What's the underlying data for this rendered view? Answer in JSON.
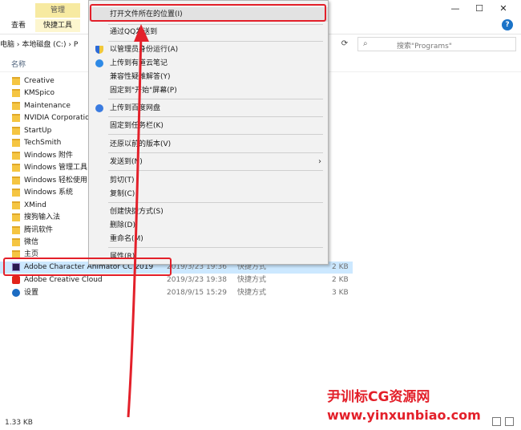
{
  "ribbon": {
    "manage_tab": "管理",
    "view_tab": "查看",
    "tools_tab": "快捷工具",
    "help_label": "?",
    "minimize": "—",
    "maximize": "☐",
    "close": "✕"
  },
  "address": {
    "path": "电脑 › 本地磁盘 (C:) › P",
    "search_placeholder": "搜索\"Programs\""
  },
  "list": {
    "column_name": "名称",
    "folders": [
      "Creative",
      "KMSpico",
      "Maintenance",
      "NVIDIA Corporatio",
      "StartUp",
      "TechSmith",
      "Windows 附件",
      "Windows 管理工具",
      "Windows 轻松使用",
      "Windows 系统",
      "XMind",
      "搜狗输入法",
      "腾讯软件",
      "微信",
      "主页"
    ],
    "files": [
      {
        "name": "Adobe Character Animator CC 2019",
        "date": "2019/3/23 19:36",
        "type": "快捷方式",
        "size": "2 KB"
      },
      {
        "name": "Adobe Creative Cloud",
        "date": "2019/3/23 19:38",
        "type": "快捷方式",
        "size": "2 KB"
      },
      {
        "name": "设置",
        "date": "2018/9/15 15:29",
        "type": "快捷方式",
        "size": "3 KB"
      }
    ]
  },
  "status": {
    "text": "1.33 KB"
  },
  "context_menu": {
    "items": [
      "打开文件所在的位置(I)",
      "通过QQ发送到",
      "以管理员身份运行(A)",
      "上传到有道云笔记",
      "兼容性疑难解答(Y)",
      "固定到\"开始\"屏幕(P)",
      "上传到百度网盘",
      "固定到任务栏(K)",
      "还原以前的版本(V)",
      "发送到(N)",
      "剪切(T)",
      "复制(C)",
      "创建快捷方式(S)",
      "删除(D)",
      "重命名(M)",
      "属性(R)"
    ]
  },
  "watermark": {
    "title": "尹训标CG资源网",
    "url": "www.yinxunbiao.com"
  },
  "colors": {
    "annotation_red": "#e3202a",
    "selection_blue": "#cce8ff"
  }
}
